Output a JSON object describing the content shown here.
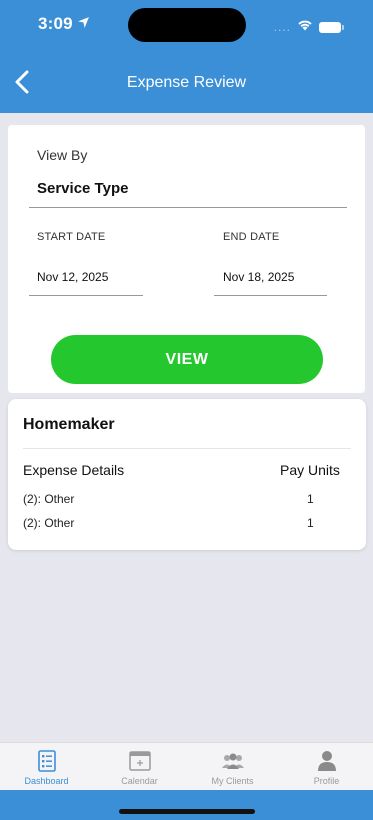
{
  "status_bar": {
    "time": "3:09",
    "signal_dots": "....",
    "icons": [
      "location-arrow-icon",
      "wifi-icon",
      "battery-icon"
    ]
  },
  "header": {
    "title": "Expense Review",
    "background": "#3b8fd7"
  },
  "filter": {
    "view_by_label": "View By",
    "view_by_value": "Service Type",
    "start_date_label": "START DATE",
    "start_date_value": "Nov 12, 2025",
    "end_date_label": "END DATE",
    "end_date_value": "Nov 18, 2025",
    "view_button_label": "VIEW",
    "button_color": "#25c72f"
  },
  "results": {
    "service_title": "Homemaker",
    "columns": [
      "Expense Details",
      "Pay Units"
    ],
    "rows": [
      {
        "detail_prefix": "(2):",
        "detail": "Other",
        "units": "1"
      },
      {
        "detail_prefix": "(2):",
        "detail": "Other",
        "units": "1"
      }
    ]
  },
  "tabbar": {
    "tabs": [
      {
        "label": "Dashboard",
        "icon": "dashboard-icon",
        "active": true
      },
      {
        "label": "Calendar",
        "icon": "calendar-icon",
        "active": false
      },
      {
        "label": "My Clients",
        "icon": "clients-icon",
        "active": false
      },
      {
        "label": "Profile",
        "icon": "profile-icon",
        "active": false
      }
    ],
    "active_color": "#3b8fd7"
  }
}
